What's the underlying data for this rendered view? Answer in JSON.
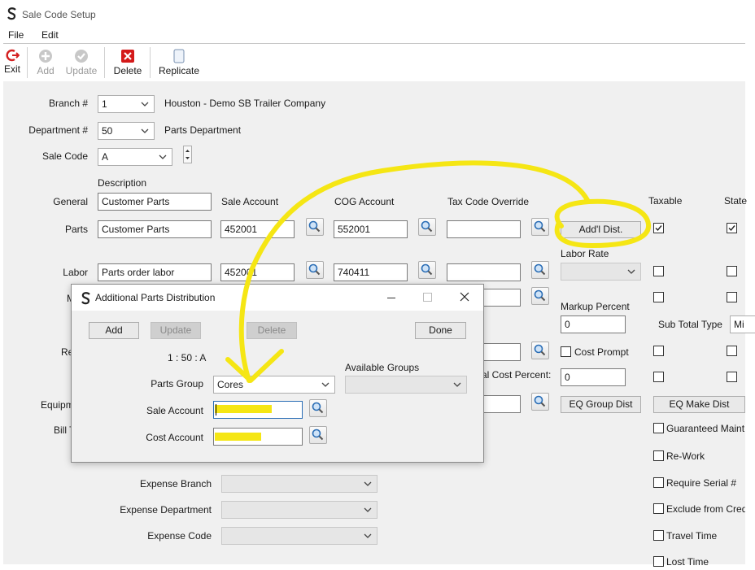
{
  "window": {
    "title": "Sale Code Setup"
  },
  "menu": {
    "file": "File",
    "edit": "Edit"
  },
  "toolbar": {
    "exit": "Exit",
    "add": "Add",
    "update": "Update",
    "delete": "Delete",
    "replicate": "Replicate"
  },
  "form": {
    "branch_label": "Branch #",
    "branch_value": "1",
    "branch_name": "Houston - Demo SB Trailer Company",
    "department_label": "Department #",
    "department_value": "50",
    "department_name": "Parts Department",
    "salecode_label": "Sale Code",
    "salecode_value": "A",
    "description_header": "Description",
    "sale_account_header": "Sale Account",
    "cog_account_header": "COG Account",
    "tax_override_header": "Tax Code Override",
    "taxable_header": "Taxable",
    "state_header": "State",
    "general_label": "General",
    "general_desc": "Customer Parts",
    "parts_label": "Parts",
    "parts_desc": "Customer Parts",
    "parts_sale": "452001",
    "parts_cog": "552001",
    "addl_dist": "Add'l Dist.",
    "labor_rate_label": "Labor Rate",
    "labor_label": "Labor",
    "labor_desc": "Parts order labor",
    "labor_sale": "452001",
    "labor_cog": "740411",
    "misc_label_partial": "M",
    "markup_label": "Markup Percent",
    "markup_value": "0",
    "subtotal_label": "Sub Total Type",
    "subtotal_value": "Mi",
    "re_partial": "Re",
    "cost_prompt": "Cost Prompt",
    "cost_percent_partial": "al Cost Percent:",
    "cost_percent_value": "0",
    "equip_partial": "Equipm",
    "bill_partial": "Bill T",
    "eq_group_dist": "EQ Group Dist",
    "eq_make_dist": "EQ Make Dist",
    "guaranteed_maint": "Guaranteed Maint",
    "rework": "Re-Work",
    "require_serial": "Require Serial #",
    "exclude_from_cred": "Exclude from Cred",
    "travel_time": "Travel Time",
    "lost_time": "Lost Time",
    "expense_branch_label": "Expense Branch",
    "expense_department_label": "Expense Department",
    "expense_code_label": "Expense Code"
  },
  "dialog": {
    "title": "Additional Parts Distribution",
    "add": "Add",
    "update": "Update",
    "delete": "Delete",
    "done": "Done",
    "key": "1 : 50 : A",
    "parts_group_label": "Parts Group",
    "parts_group_value": "Cores",
    "available_groups_label": "Available Groups",
    "sale_account_label": "Sale Account",
    "cost_account_label": "Cost Account"
  },
  "colors": {
    "highlight": "#f5e614",
    "exit_red": "#d42020",
    "delete_red": "#d41a1a"
  }
}
